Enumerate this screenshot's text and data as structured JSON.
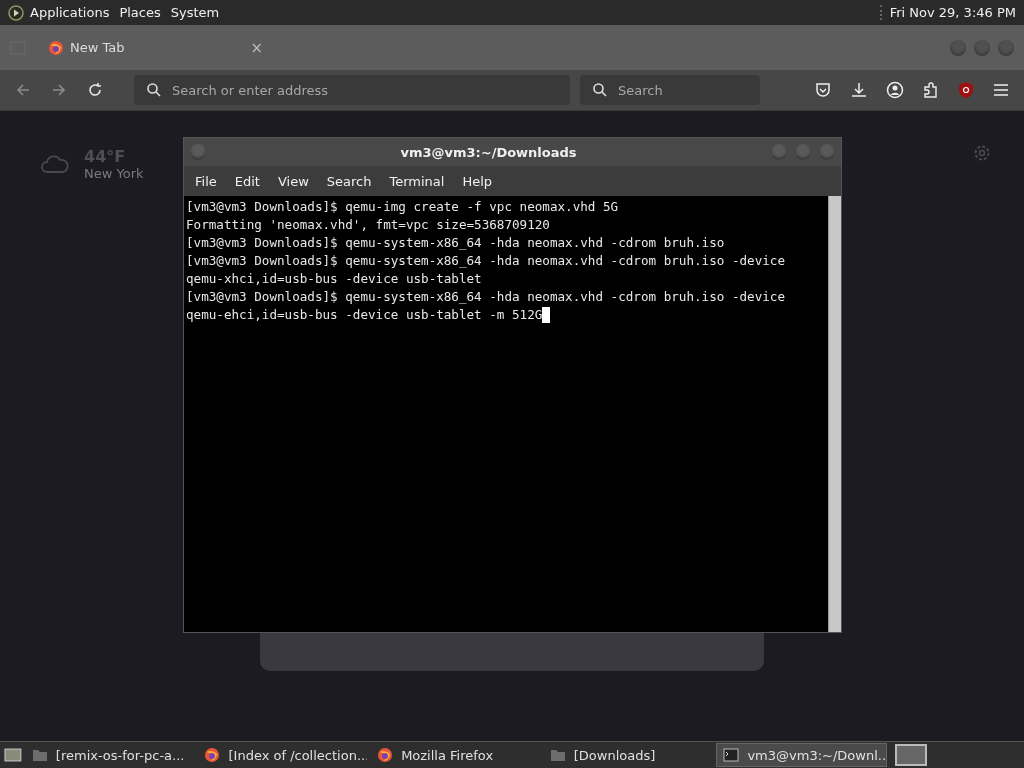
{
  "top_panel": {
    "menus": [
      "Applications",
      "Places",
      "System"
    ],
    "clock": "Fri Nov 29,  3:46 PM"
  },
  "browser": {
    "tab": {
      "title": "New Tab",
      "close": "×"
    },
    "address": {
      "placeholder": "Search or enter address"
    },
    "search": {
      "placeholder": "Search"
    }
  },
  "new_tab_page": {
    "weather": {
      "temperature": "44°F",
      "city": "New York"
    }
  },
  "terminal": {
    "title": "vm3@vm3:~/Downloads",
    "menus": [
      "File",
      "Edit",
      "View",
      "Search",
      "Terminal",
      "Help"
    ],
    "lines": [
      "[vm3@vm3 Downloads]$ qemu-img create -f vpc neomax.vhd 5G",
      "Formatting 'neomax.vhd', fmt=vpc size=5368709120",
      "[vm3@vm3 Downloads]$ qemu-system-x86_64 -hda neomax.vhd -cdrom bruh.iso",
      "[vm3@vm3 Downloads]$ qemu-system-x86_64 -hda neomax.vhd -cdrom bruh.iso -device",
      "qemu-xhci,id=usb-bus -device usb-tablet",
      "[vm3@vm3 Downloads]$ qemu-system-x86_64 -hda neomax.vhd -cdrom bruh.iso -device",
      "qemu-ehci,id=usb-bus -device usb-tablet -m 512G"
    ]
  },
  "taskbar": {
    "items": [
      {
        "label": "[remix-os-for-pc-a...",
        "kind": "folder",
        "selected": false
      },
      {
        "label": "[Index of /collection...",
        "kind": "browser",
        "selected": false
      },
      {
        "label": "Mozilla Firefox",
        "kind": "browser",
        "selected": false
      },
      {
        "label": "[Downloads]",
        "kind": "folder",
        "selected": false
      },
      {
        "label": "vm3@vm3:~/Downl...",
        "kind": "terminal",
        "selected": true
      }
    ]
  }
}
